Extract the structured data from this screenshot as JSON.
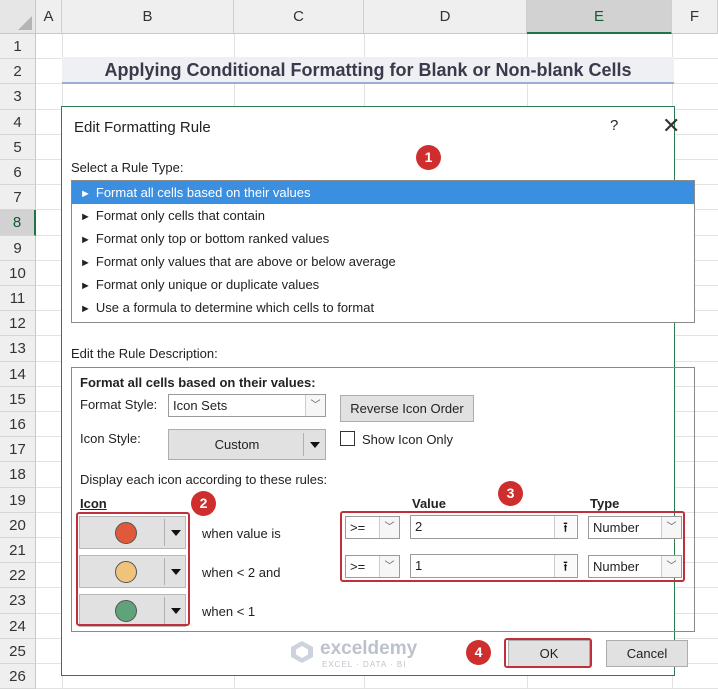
{
  "sheet": {
    "columns": [
      "A",
      "B",
      "C",
      "D",
      "E",
      "F"
    ],
    "selected_column": "E",
    "rows": [
      "1",
      "2",
      "3",
      "4",
      "5",
      "6",
      "7",
      "8",
      "9",
      "10",
      "11",
      "12",
      "13",
      "14",
      "15",
      "16",
      "17",
      "18",
      "19",
      "20",
      "21",
      "22",
      "23",
      "24",
      "25",
      "26"
    ],
    "selected_row": "8",
    "title": "Applying Conditional Formatting for Blank or Non-blank Cells"
  },
  "dialog": {
    "title": "Edit Formatting Rule",
    "help": "?",
    "close": "✕",
    "select_rule_label": "Select a Rule Type:",
    "rule_types": [
      "Format all cells based on their values",
      "Format only cells that contain",
      "Format only top or bottom ranked values",
      "Format only values that are above or below average",
      "Format only unique or duplicate values",
      "Use a formula to determine which cells to format"
    ],
    "edit_desc_label": "Edit the Rule Description:",
    "desc_heading": "Format all cells based on their values:",
    "format_style_label": "Format Style:",
    "format_style_value": "Icon Sets",
    "reverse_button": "Reverse Icon Order",
    "icon_style_label": "Icon Style:",
    "icon_style_value": "Custom",
    "show_icon_only": "Show Icon Only",
    "display_rules_label": "Display each icon according to these rules:",
    "col_icon": "Icon",
    "col_value": "Value",
    "col_type": "Type",
    "icon_rules": [
      {
        "color": "#e0593a",
        "text": "when value is",
        "operator": ">=",
        "value": "2",
        "type": "Number"
      },
      {
        "color": "#f0c37a",
        "text": "when < 2 and",
        "operator": ">=",
        "value": "1",
        "type": "Number"
      },
      {
        "color": "#5fa37a",
        "text": "when < 1"
      }
    ],
    "ok": "OK",
    "cancel": "Cancel"
  },
  "badges": [
    "1",
    "2",
    "3",
    "4"
  ],
  "watermark": {
    "name": "exceldemy",
    "tagline": "EXCEL · DATA · BI"
  },
  "colors": {
    "accent": "#217346",
    "highlight": "#c0303a",
    "selection": "#3b8fe0"
  }
}
